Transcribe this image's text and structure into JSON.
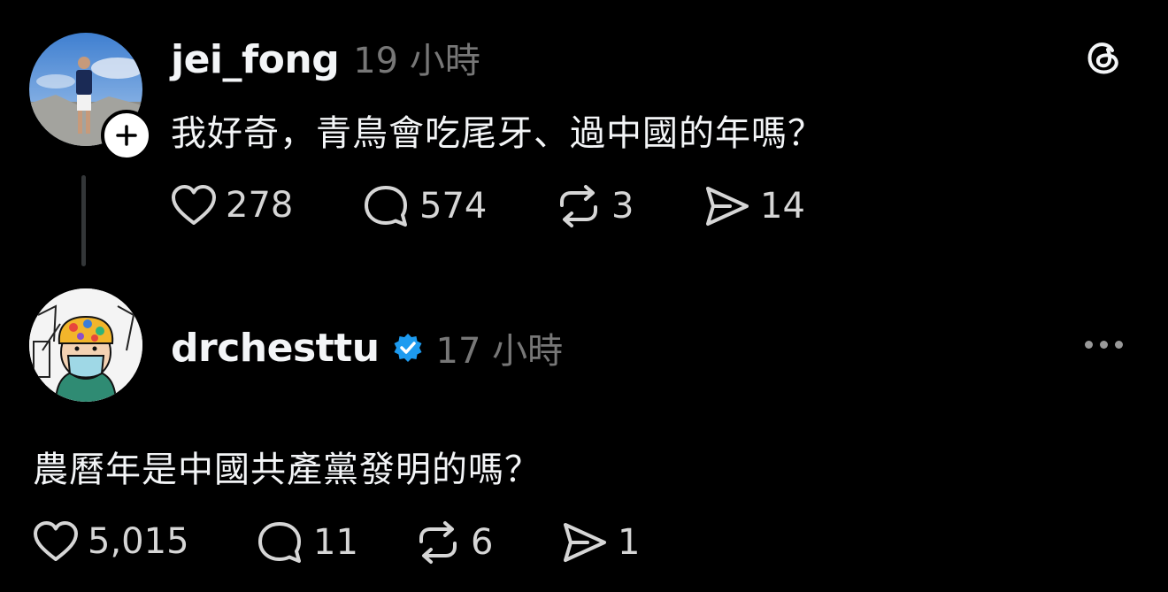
{
  "post1": {
    "username": "jei_fong",
    "time": "19 小時",
    "text": "我好奇，青鳥會吃尾牙、過中國的年嗎？",
    "actions": {
      "likes": "278",
      "replies": "574",
      "reposts": "3",
      "shares": "14"
    }
  },
  "post2": {
    "username": "drchesttu",
    "verified": true,
    "time": "17 小時",
    "text": "農曆年是中國共產黨發明的嗎？",
    "actions": {
      "likes": "5,015",
      "replies": "11",
      "reposts": "6",
      "shares": "1"
    }
  },
  "icons": {
    "app_logo": "threads-logo-icon",
    "like": "heart-icon",
    "reply": "comment-icon",
    "repost": "repost-icon",
    "share": "share-icon",
    "more": "more-options-icon",
    "follow": "plus-icon",
    "verified": "verified-badge-icon"
  },
  "colors": {
    "background": "#000000",
    "text": "#f3f5f7",
    "muted": "#777777",
    "verified": "#1d9bf0"
  }
}
